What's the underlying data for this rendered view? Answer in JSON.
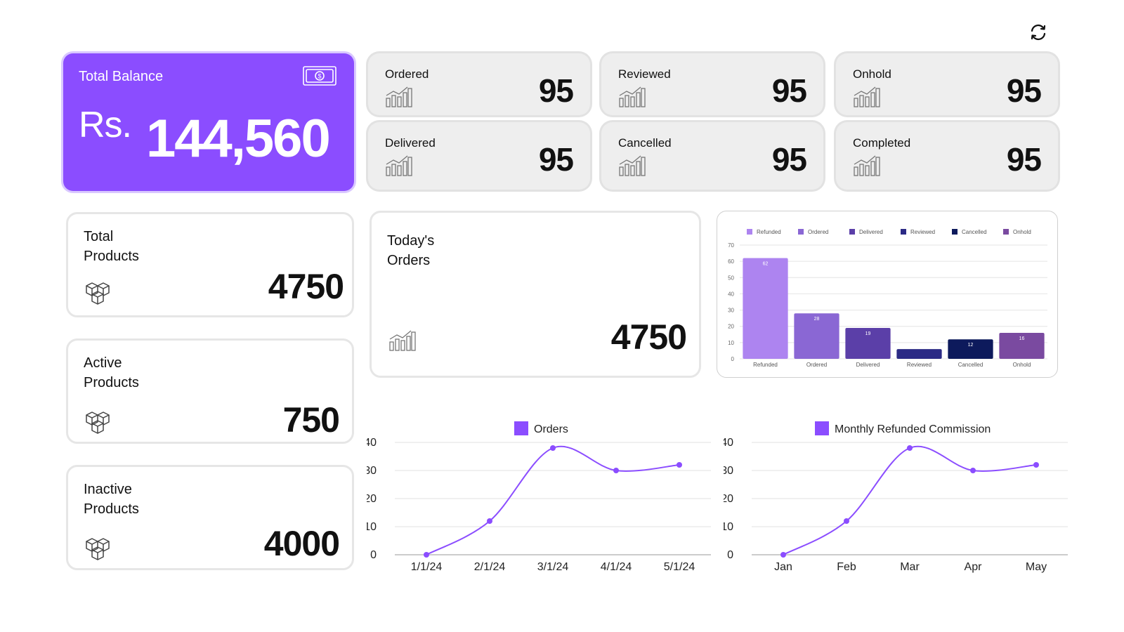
{
  "balance": {
    "label": "Total Balance",
    "currency": "Rs.",
    "amount": "144,560",
    "icon": "money-icon"
  },
  "stats": [
    {
      "label": "Ordered",
      "value": "95",
      "icon": "bar-growth-icon"
    },
    {
      "label": "Reviewed",
      "value": "95",
      "icon": "bar-growth-icon"
    },
    {
      "label": "Onhold",
      "value": "95",
      "icon": "bar-growth-icon"
    },
    {
      "label": "Delivered",
      "value": "95",
      "icon": "bar-growth-icon"
    },
    {
      "label": "Cancelled",
      "value": "95",
      "icon": "bar-growth-icon"
    },
    {
      "label": "Completed",
      "value": "95",
      "icon": "bar-growth-icon"
    }
  ],
  "products": {
    "total": {
      "label": "Total\nProducts",
      "value": "4750",
      "icon": "boxes-icon"
    },
    "active": {
      "label": "Active\nProducts",
      "value": "750",
      "icon": "boxes-icon"
    },
    "inactive": {
      "label": "Inactive\nProducts",
      "value": "4000",
      "icon": "boxes-icon"
    }
  },
  "today": {
    "label": "Today's\nOrders",
    "value": "4750",
    "icon": "bar-growth-icon"
  },
  "refresh_icon": "refresh-icon",
  "chart_data": [
    {
      "type": "bar",
      "categories": [
        "Refunded",
        "Ordered",
        "Delivered",
        "Reviewed",
        "Cancelled",
        "Onhold"
      ],
      "values": [
        62,
        28,
        19,
        6,
        12,
        16
      ],
      "data_labels": [
        "62",
        "28",
        "19",
        "",
        "12",
        "16"
      ],
      "legend": [
        "Refunded",
        "Ordered",
        "Delivered",
        "Reviewed",
        "Cancelled",
        "Onhold"
      ],
      "colors": [
        "#ad84f0",
        "#8a67d4",
        "#5b3fa8",
        "#2b2a85",
        "#0d1a5c",
        "#7a4aa0"
      ],
      "yticks": [
        "0",
        "10",
        "20",
        "30",
        "40",
        "50",
        "60",
        "70"
      ],
      "ylim": [
        0,
        70
      ],
      "legend_position": "top",
      "grid": true
    },
    {
      "type": "line",
      "series": [
        {
          "name": "Orders",
          "values": [
            0,
            12,
            38,
            30,
            32
          ]
        }
      ],
      "x": [
        "1/1/24",
        "2/1/24",
        "3/1/24",
        "4/1/24",
        "5/1/24"
      ],
      "yticks": [
        "0",
        "10",
        "20",
        "30",
        "40"
      ],
      "ylim": [
        0,
        40
      ],
      "color": "#8b4dff",
      "legend_position": "top",
      "grid": true
    },
    {
      "type": "line",
      "series": [
        {
          "name": "Monthly Refunded Commission",
          "values": [
            0,
            12,
            38,
            30,
            32
          ]
        }
      ],
      "x": [
        "Jan",
        "Feb",
        "Mar",
        "Apr",
        "May"
      ],
      "yticks": [
        "0",
        "10",
        "20",
        "30",
        "40"
      ],
      "ylim": [
        0,
        40
      ],
      "color": "#8b4dff",
      "legend_position": "top",
      "grid": true
    }
  ]
}
